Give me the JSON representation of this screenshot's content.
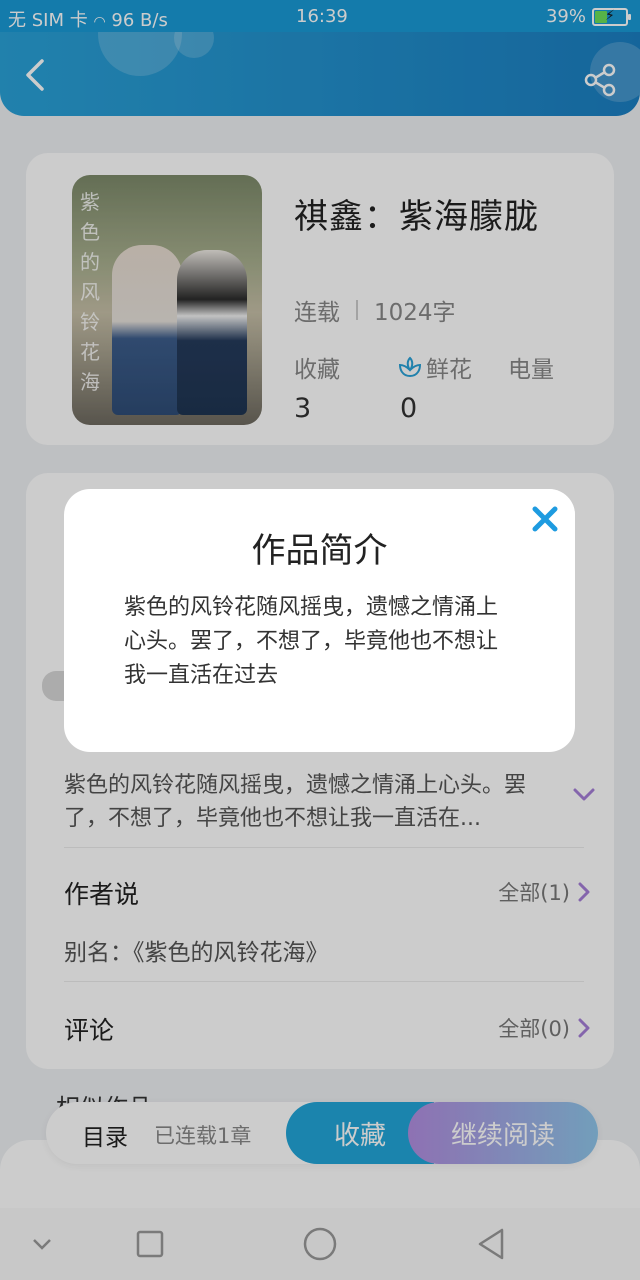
{
  "status_bar": {
    "carrier": "无 SIM 卡",
    "speed": "96 B/s",
    "time": "16:39",
    "battery": "39%",
    "battery_level": 0.39
  },
  "header": {
    "back_icon": "chevron-left-icon",
    "share_icon": "share-icon"
  },
  "book": {
    "title": "祺鑫：紫海朦胧",
    "status": "连载",
    "word_count": "1024字",
    "cover_text": "紫色的风铃花海",
    "stats": {
      "favorites_label": "收藏",
      "favorites_value": "3",
      "flowers_label": "鲜花",
      "flowers_value": "0",
      "power_label": "电量"
    }
  },
  "info": {
    "intro_preview": "紫色的风铃花随风摇曳，遗憾之情涌上心头。罢了，不想了，毕竟他也不想让我一直活在...",
    "author_says": {
      "title": "作者说",
      "link": "全部(1)",
      "alias": "别名：《紫色的风铃花海》"
    },
    "comments": {
      "title": "评论",
      "link": "全部(0)"
    }
  },
  "similar": {
    "title": "相似作品"
  },
  "action_bar": {
    "catalog": "目录",
    "chapters": "已连载1章",
    "collect": "收藏",
    "continue_reading": "继续阅读"
  },
  "modal": {
    "title": "作品简介",
    "body": "紫色的风铃花随风摇曳，遗憾之情涌上心头。罢了，不想了，毕竟他也不想让我一直活在过去",
    "close_icon": "close-icon"
  },
  "colors": {
    "header": "#1b8fcf",
    "accent": "#22a6d9",
    "purple": "#a57fd8"
  }
}
